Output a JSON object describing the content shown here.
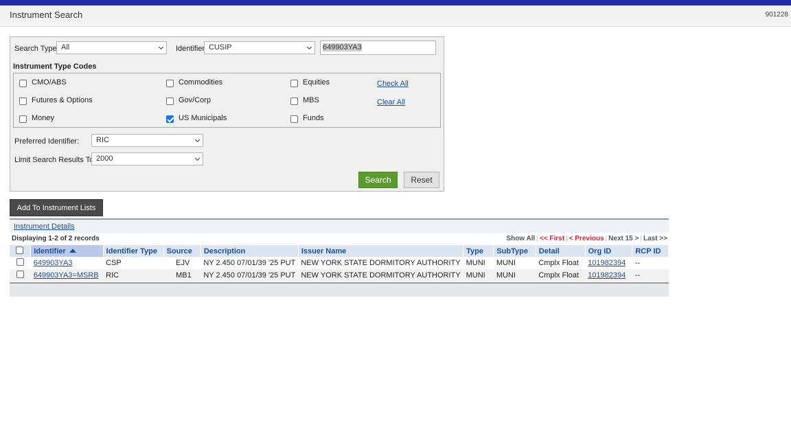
{
  "header": {
    "title": "Instrument Search",
    "code": "901228"
  },
  "search": {
    "search_type_label": "Search Type:",
    "search_type_value": "All",
    "identifier_label": "Identifier:",
    "identifier_value": "CUSIP",
    "identifier_text": "649903YA3",
    "codes_heading": "Instrument Type Codes",
    "codes": [
      {
        "label": "CMO/ABS",
        "checked": false
      },
      {
        "label": "Commodities",
        "checked": false
      },
      {
        "label": "Equities",
        "checked": false
      },
      {
        "label": "Futures & Options",
        "checked": false
      },
      {
        "label": "Gov/Corp",
        "checked": false
      },
      {
        "label": "MBS",
        "checked": false
      },
      {
        "label": "Money",
        "checked": false
      },
      {
        "label": "US Municipals",
        "checked": true
      },
      {
        "label": "Funds",
        "checked": false
      }
    ],
    "check_all": "Check All",
    "clear_all": "Clear All",
    "preferred_label": "Preferred Identifier:",
    "preferred_value": "RIC",
    "limit_label": "Limit Search Results To:",
    "limit_value": "2000",
    "search_button": "Search",
    "reset_button": "Reset"
  },
  "add_button": "Add To Instrument Lists",
  "results": {
    "tab_link": "Instrument Details",
    "display_text": "Displaying 1-2 of 2 records",
    "pager": {
      "show_all": "Show All",
      "first": "<< First",
      "previous": "< Previous",
      "next": "Next 15 >",
      "last": "Last >>"
    },
    "columns": [
      "Identifier",
      "Identifier Type",
      "Source",
      "Description",
      "Issuer Name",
      "Type",
      "SubType",
      "Detail",
      "Org ID",
      "RCP ID"
    ],
    "rows": [
      {
        "identifier": "649903YA3",
        "identifier_type": "CSP",
        "source": "EJV",
        "description": "NY 2.450 07/01/39 '25 PUT",
        "issuer": "NEW YORK STATE DORMITORY AUTHORITY",
        "type": "MUNI",
        "subtype": "MUNI",
        "detail": "Cmplx Float",
        "org_id": "101982394",
        "rcp_id": "--"
      },
      {
        "identifier": "649903YA3=MSRB",
        "identifier_type": "RIC",
        "source": "MB1",
        "description": "NY 2.450 07/01/39 '25 PUT",
        "issuer": "NEW YORK STATE DORMITORY AUTHORITY",
        "type": "MUNI",
        "subtype": "MUNI",
        "detail": "Cmplx Float",
        "org_id": "101982394",
        "rcp_id": "--"
      }
    ]
  }
}
